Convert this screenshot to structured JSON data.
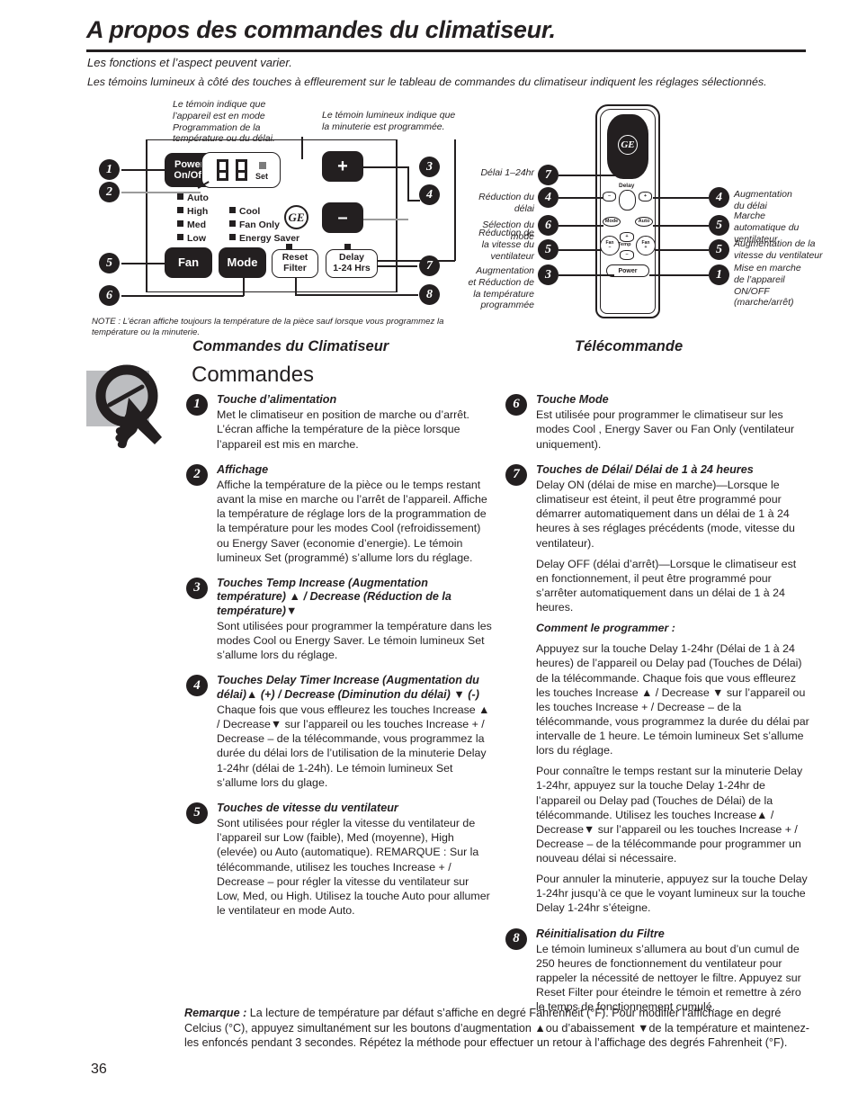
{
  "header": {
    "title": "A propos des commandes du climatiseur.",
    "subtitle1": "Les fonctions et l’aspect peuvent varier.",
    "subtitle2": "Les témoins lumineux à côté des touches à effleurement sur le tableau de commandes du climatiseur indiquent les réglages sélectionnés."
  },
  "control_panel": {
    "annotation_left": "Le témoin indique que l’appareil est en mode Programmation de la température ou du délai.",
    "annotation_right": "Le témoin lumineux indique que la minuterie est programmée.",
    "buttons": {
      "power_line1": "Power",
      "power_line2": "On/Off",
      "plus": "+",
      "minus": "–",
      "fan": "Fan",
      "mode": "Mode",
      "reset_line1": "Reset",
      "reset_line2": "Filter",
      "delay_line1": "Delay",
      "delay_line2": "1-24 Hrs"
    },
    "display": {
      "set_label": "Set"
    },
    "indicators_left": [
      "Auto",
      "High",
      "Med",
      "Low"
    ],
    "indicators_right": [
      "Cool",
      "Fan Only",
      "Energy Saver"
    ],
    "brand": "GE",
    "callouts": [
      "1",
      "2",
      "3",
      "4",
      "5",
      "6",
      "7",
      "8"
    ],
    "note": "NOTE : L’écran affiche toujours la température de la pièce sauf lorsque vous programmez la température ou la minuterie."
  },
  "remote": {
    "brand": "GE",
    "buttons": {
      "delay": "Delay",
      "delay_minus": "–",
      "delay_plus": "+",
      "mode": "Mode",
      "auto": "Auto",
      "fan_minus": "Fan\n–",
      "fan_plus": "Fan\n+",
      "temp": "Temp",
      "temp_plus": "+",
      "temp_minus": "–",
      "power": "Power"
    },
    "labels_left": [
      {
        "num": "7",
        "text": "Délai 1–24hr"
      },
      {
        "num": "4",
        "text": "Réduction du délai"
      },
      {
        "num": "6",
        "text": "Sélection du mode"
      },
      {
        "num": "5",
        "text": "Réduction de\nla vitesse du\nventilateur"
      },
      {
        "num": "3",
        "text": "Augmentation\net Réduction de\nla température\nprogrammée"
      }
    ],
    "labels_right": [
      {
        "num": "4",
        "text": "Augmentation\ndu délai"
      },
      {
        "num": "5",
        "text": "Marche\nautomatique du\nventilateur"
      },
      {
        "num": "5",
        "text": "Augmentation de la\nvitesse du ventilateur"
      },
      {
        "num": "1",
        "text": "Mise en marche\nde l’appareil ON/OFF\n(marche/arrêt)"
      }
    ]
  },
  "headings": {
    "left_sub": "Commandes du Climatiseur",
    "left_big": "Commandes",
    "right_sub": "Télécommande"
  },
  "items_left": [
    {
      "num": "1",
      "title": "Touche d’alimentation",
      "paragraphs": [
        "Met le climatiseur en position de marche ou d’arrêt. L’écran affiche la température de la pièce lorsque l’appareil est mis en marche."
      ]
    },
    {
      "num": "2",
      "title": "Affichage",
      "paragraphs": [
        "Affiche la température de la pièce ou le temps restant avant la mise en marche ou l’arrêt de l’appareil. Affiche la température de réglage lors de la programmation de la température pour les modes Cool (refroidissement) ou Energy Saver (economie d’energie). Le témoin lumineux Set (programmé) s’allume lors du réglage."
      ]
    },
    {
      "num": "3",
      "title": "Touches Temp Increase (Augmentation température) ▲ / Decrease (Réduction de la température)▼",
      "paragraphs": [
        "Sont utilisées pour programmer la température dans les modes Cool ou Energy Saver. Le témoin lumineux Set s’allume lors du réglage."
      ]
    },
    {
      "num": "4",
      "title": "Touches Delay Timer Increase (Augmentation du délai)▲ (+) / Decrease (Diminution du délai) ▼ (-)",
      "paragraphs": [
        "Chaque fois que vous effleurez les touches Increase ▲ / Decrease▼ sur l’appareil ou les touches Increase + / Decrease – de la télécommande, vous programmez la durée du délai lors de l’utilisation de la minuterie Delay 1-24hr (délai de 1-24h). Le témoin lumineux Set s’allume lors du glage."
      ]
    },
    {
      "num": "5",
      "title": "Touches de vitesse du ventilateur",
      "paragraphs": [
        "Sont utilisées pour régler la vitesse du ventilateur de l’appareil sur Low (faible), Med (moyenne), High (elevée) ou Auto (automatique). REMARQUE : Sur la télécommande, utilisez les touches Increase + / Decrease – pour régler la vitesse du ventilateur sur Low, Med, ou High. Utilisez la touche Auto pour allumer le ventilateur en mode Auto."
      ]
    }
  ],
  "items_right": [
    {
      "num": "6",
      "title": "Touche Mode",
      "paragraphs": [
        "Est utilisée pour programmer le climatiseur sur les modes Cool , Energy Saver ou Fan Only (ventilateur uniquement)."
      ]
    },
    {
      "num": "7",
      "title": "Touches de Délai/ Délai de 1 à 24 heures",
      "paragraphs": [
        "Delay ON (délai de mise en marche)—Lorsque le climatiseur est éteint, il peut être programmé pour démarrer automatiquement dans un délai de 1 à 24 heures à ses réglages précédents (mode, vitesse du ventilateur).",
        "Delay OFF (délai d’arrêt)—Lorsque le climatiseur est en fonctionnement, il peut être programmé pour s’arrêter automatiquement dans un délai de 1 à 24 heures.",
        "Comment le programmer :",
        "Appuyez sur la touche Delay 1-24hr (Délai de 1 à 24 heures) de l’appareil ou Delay pad (Touches de Délai) de la télécommande. Chaque fois que vous effleurez les touches Increase ▲ / Decrease ▼ sur l’appareil ou les touches Increase + / Decrease –  de la télécommande, vous programmez la durée du délai par intervalle de 1 heure. Le témoin lumineux Set s’allume lors du réglage.",
        "Pour connaître le temps restant sur la minuterie Delay 1-24hr, appuyez sur la touche Delay 1-24hr de l’appareil ou Delay pad (Touches de Délai) de la télécommande. Utilisez les touches Increase▲ / Decrease▼ sur l’appareil ou les touches Increase + / Decrease – de la télécommande pour programmer un nouveau délai si nécessaire.",
        "Pour annuler la minuterie, appuyez sur la touche Delay 1-24hr jusqu’à ce que le voyant lumineux sur la touche Delay 1-24hr s’éteigne."
      ]
    },
    {
      "num": "8",
      "title": "Réinitialisation du Filtre",
      "paragraphs": [
        "Le témoin lumineux s’allumera au bout d’un cumul de 250 heures de fonctionnement du ventilateur pour rappeler la nécessité de nettoyer le filtre. Appuyez sur Reset Filter pour éteindre le témoin et remettre à zéro le temps de fonctionnement cumulé."
      ]
    }
  ],
  "footer": {
    "remark_label": "Remarque :",
    "remark_text": " La lecture de température par défaut s’affiche en degré Fahrenheit (°F). Pour modifier l’affichage en degré Celcius (°C), appuyez simultanément sur les boutons d’augmentation ▲ou d’abaissement ▼de la température et maintenez-les enfoncés pendant 3 secondes. Répétez la méthode pour effectuer un retour à l’affichage des degrés Fahrenheit (°F).",
    "page_number": "36"
  },
  "colors": {
    "ink": "#231f20",
    "gray_leader": "#9b9b9b",
    "gray_fill": "#bcbdc0",
    "led_gray": "#7c7c7c"
  }
}
